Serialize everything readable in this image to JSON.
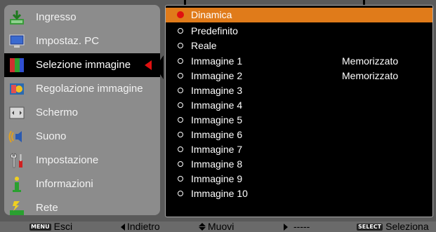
{
  "menu": {
    "items": [
      {
        "label": "Ingresso",
        "icon": "input-icon"
      },
      {
        "label": "Impostaz. PC",
        "icon": "pc-icon"
      },
      {
        "label": "Selezione immagine",
        "icon": "image-select-icon"
      },
      {
        "label": "Regolazione immagine",
        "icon": "image-adjust-icon"
      },
      {
        "label": "Schermo",
        "icon": "screen-icon"
      },
      {
        "label": "Suono",
        "icon": "sound-icon"
      },
      {
        "label": "Impostazione",
        "icon": "settings-icon"
      },
      {
        "label": "Informazioni",
        "icon": "info-icon"
      },
      {
        "label": "Rete",
        "icon": "network-icon"
      }
    ],
    "selected_index": 2
  },
  "options": {
    "items": [
      {
        "label": "Dinamica",
        "status": ""
      },
      {
        "label": "Predefinito",
        "status": ""
      },
      {
        "label": "Reale",
        "status": ""
      },
      {
        "label": "Immagine 1",
        "status": "Memorizzato"
      },
      {
        "label": "Immagine 2",
        "status": "Memorizzato"
      },
      {
        "label": "Immagine 3",
        "status": ""
      },
      {
        "label": "Immagine 4",
        "status": ""
      },
      {
        "label": "Immagine 5",
        "status": ""
      },
      {
        "label": "Immagine 6",
        "status": ""
      },
      {
        "label": "Immagine 7",
        "status": ""
      },
      {
        "label": "Immagine 8",
        "status": ""
      },
      {
        "label": "Immagine 9",
        "status": ""
      },
      {
        "label": "Immagine 10",
        "status": ""
      }
    ],
    "highlighted_index": 0
  },
  "bottom": {
    "menu_key": "MENU",
    "esci": "Esci",
    "indietro": "Indietro",
    "muovi": "Muovi",
    "right_value": "-----",
    "select_key": "SELECT",
    "seleziona": "Seleziona"
  },
  "colors": {
    "highlight": "#e07b1a",
    "selected_marker": "#e01010",
    "panel_bg": "#8c8c8c",
    "list_bg": "#000000"
  }
}
